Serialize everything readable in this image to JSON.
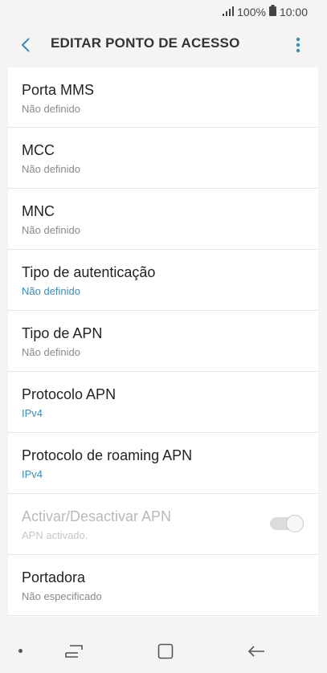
{
  "status_bar": {
    "battery": "100%",
    "time": "10:00",
    "icons": [
      "signal-icon",
      "battery-icon"
    ]
  },
  "app_bar": {
    "title": "EDITAR PONTO DE ACESSO",
    "back_icon": "chevron-left-icon",
    "more_icon": "more-vertical-icon"
  },
  "items": [
    {
      "title": "Porta MMS",
      "subtitle": "Não definido",
      "accent": false
    },
    {
      "title": "MCC",
      "subtitle": "Não definido",
      "accent": false
    },
    {
      "title": "MNC",
      "subtitle": "Não definido",
      "accent": false
    },
    {
      "title": "Tipo de autenticação",
      "subtitle": "Não definido",
      "accent": true
    },
    {
      "title": "Tipo de APN",
      "subtitle": "Não definido",
      "accent": false
    },
    {
      "title": "Protocolo APN",
      "subtitle": "IPv4",
      "accent": true
    },
    {
      "title": "Protocolo de roaming APN",
      "subtitle": "IPv4",
      "accent": true
    },
    {
      "title": "Activar/Desactivar APN",
      "subtitle": "APN activado.",
      "accent": false,
      "disabled": true,
      "toggle_on": true
    },
    {
      "title": "Portadora",
      "subtitle": "Não especificado",
      "accent": false
    }
  ],
  "nav_bar": {
    "icons": [
      "dot-icon",
      "recent-apps-icon",
      "home-icon",
      "back-arrow-icon"
    ]
  },
  "colors": {
    "accent": "#3a8bb8",
    "background": "#f4f4f4",
    "list_background": "#ffffff"
  }
}
